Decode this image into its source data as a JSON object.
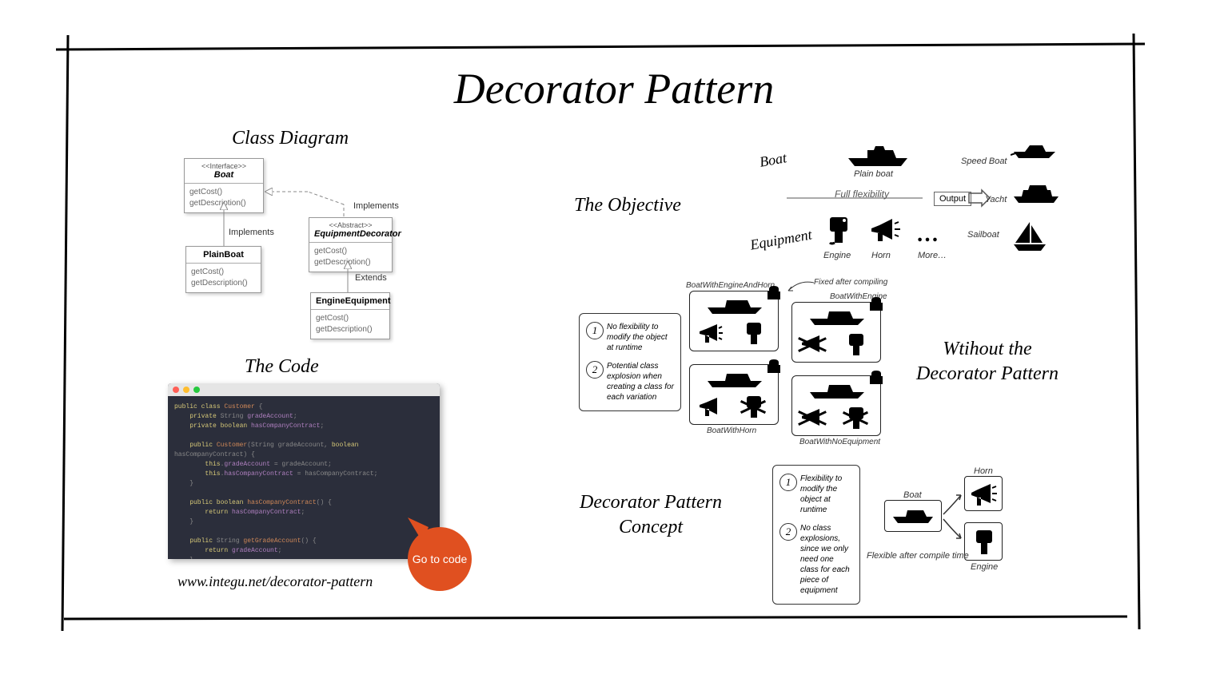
{
  "title": "Decorator Pattern",
  "sections": {
    "class_diagram": "Class Diagram",
    "the_code": "The Code",
    "objective": "The Objective",
    "without": "Wtihout the Decorator Pattern",
    "concept": "Decorator Pattern Concept"
  },
  "uml": {
    "boat": {
      "stereo": "<<Interface>>",
      "name": "Boat",
      "m1": "getCost()",
      "m2": "getDescription()"
    },
    "plain": {
      "name": "PlainBoat",
      "m1": "getCost()",
      "m2": "getDescription()"
    },
    "deco": {
      "stereo": "<<Abstract>>",
      "name": "EquipmentDecorator",
      "m1": "getCost()",
      "m2": "getDescription()"
    },
    "engine": {
      "name": "EngineEquipment",
      "m1": "getCost()",
      "m2": "getDescription()"
    },
    "implements": "Implements",
    "extends": "Extends"
  },
  "go_to_code": "Go to code",
  "url": "www.integu.net/decorator-pattern",
  "objective": {
    "boat_label": "Boat",
    "equipment_label": "Equipment",
    "plain_boat": "Plain boat",
    "engine": "Engine",
    "horn": "Horn",
    "more": "More…",
    "flex": "Full flexibility",
    "output": "Output",
    "speed": "Speed Boat",
    "yacht": "Yacht",
    "sail": "Sailboat"
  },
  "without_info": {
    "item1": "No flexibility to modify the object at runtime",
    "item2": "Potential class explosion when creating a class for each variation"
  },
  "without_labels": {
    "fixed": "Fixed after compiling",
    "c1": "BoatWithEngineAndHorn",
    "c2": "BoatWithEngine",
    "c3": "BoatWithHorn",
    "c4": "BoatWithNoEquipment"
  },
  "concept_info": {
    "item1": "Flexibility to modify the object at runtime",
    "item2": "No class explosions, since we only need one class for each piece of equipment"
  },
  "concept_labels": {
    "boat": "Boat",
    "horn": "Horn",
    "engine": "Engine",
    "flex": "Flexible after compile time"
  },
  "code_lines": [
    "public class Customer {",
    "    private String gradeAccount;",
    "    private boolean hasCompanyContract;",
    "",
    "    public Customer(String gradeAccount, boolean hasCompanyContract) {",
    "        this.gradeAccount = gradeAccount;",
    "        this.hasCompanyContract = hasCompanyContract;",
    "    }",
    "",
    "    public boolean hasCompanyContract() {",
    "        return hasCompanyContract;",
    "    }",
    "",
    "    public String getGradeAccount() {",
    "        return gradeAccount;",
    "    }",
    "}"
  ]
}
